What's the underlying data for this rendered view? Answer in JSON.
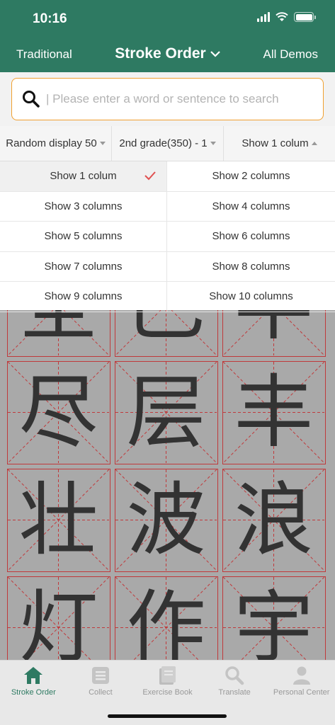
{
  "status_bar": {
    "time": "10:16"
  },
  "nav": {
    "left": "Traditional",
    "title": "Stroke Order",
    "right": "All Demos"
  },
  "search": {
    "placeholder": "| Please enter a word or sentence to search"
  },
  "filters": [
    {
      "label": "Random display 50",
      "arrow": "down"
    },
    {
      "label": "2nd grade(350) - 1",
      "arrow": "down"
    },
    {
      "label": "Show 1 colum",
      "arrow": "up"
    }
  ],
  "column_options": [
    {
      "label": "Show 1 colum",
      "selected": true
    },
    {
      "label": "Show 2 columns",
      "selected": false
    },
    {
      "label": "Show 3 columns",
      "selected": false
    },
    {
      "label": "Show 4 columns",
      "selected": false
    },
    {
      "label": "Show 5 columns",
      "selected": false
    },
    {
      "label": "Show 6 columns",
      "selected": false
    },
    {
      "label": "Show 7 columns",
      "selected": false
    },
    {
      "label": "Show 8 columns",
      "selected": false
    },
    {
      "label": "Show 9 columns",
      "selected": false
    },
    {
      "label": "Show 10 columns",
      "selected": false
    }
  ],
  "characters": [
    "全",
    "巴",
    "半",
    "尽",
    "层",
    "丰",
    "壮",
    "波",
    "浪",
    "灯",
    "作",
    "宇"
  ],
  "tabs": [
    {
      "label": "Stroke Order",
      "icon": "home-icon",
      "active": true
    },
    {
      "label": "Collect",
      "icon": "collect-icon",
      "active": false
    },
    {
      "label": "Exercise Book",
      "icon": "book-icon",
      "active": false
    },
    {
      "label": "Translate",
      "icon": "search-icon",
      "active": false
    },
    {
      "label": "Personal Center",
      "icon": "person-icon",
      "active": false
    }
  ],
  "colors": {
    "header": "#2e7a62",
    "accent_orange": "#f0a030",
    "grid_red": "#c0393b",
    "check_red": "#e05050"
  }
}
